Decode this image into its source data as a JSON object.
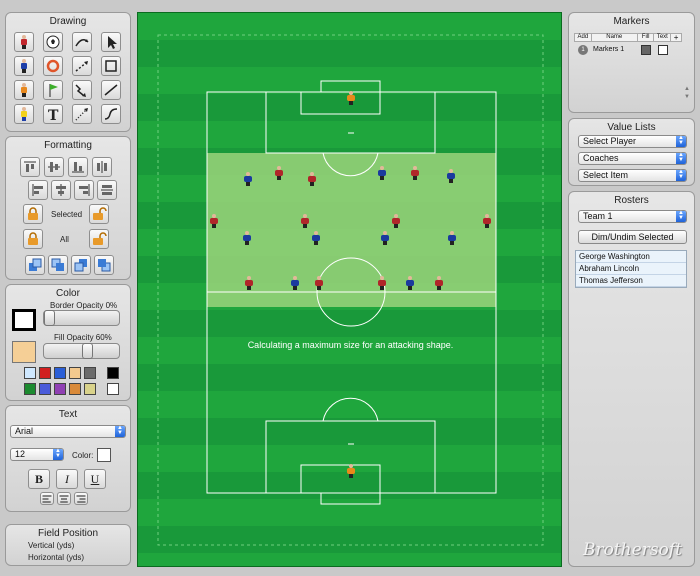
{
  "drawing": {
    "title": "Drawing",
    "tools": [
      {
        "name": "player-red-tool",
        "icon": "player-red-icon"
      },
      {
        "name": "ball-tool",
        "icon": "soccer-ball-icon"
      },
      {
        "name": "curve-arrow-tool",
        "icon": "curved-arrow-icon"
      },
      {
        "name": "select-tool",
        "icon": "pointer-arrow-icon"
      },
      {
        "name": "player-blue-tool",
        "icon": "player-blue-icon"
      },
      {
        "name": "cone-tool",
        "icon": "cone-icon"
      },
      {
        "name": "dashed-arrow-tool",
        "icon": "dashed-arrow-icon"
      },
      {
        "name": "rectangle-tool",
        "icon": "rectangle-icon"
      },
      {
        "name": "player-orange-tool",
        "icon": "player-orange-icon"
      },
      {
        "name": "flag-tool",
        "icon": "flag-icon"
      },
      {
        "name": "zigzag-arrow-tool",
        "icon": "zigzag-arrow-icon"
      },
      {
        "name": "line-tool",
        "icon": "line-icon"
      },
      {
        "name": "player-yellow-tool",
        "icon": "player-yellow-icon"
      },
      {
        "name": "text-tool",
        "icon": "text-T-icon"
      },
      {
        "name": "dotted-arrow-tool",
        "icon": "dotted-arrow-icon"
      },
      {
        "name": "freehand-tool",
        "icon": "freehand-curve-icon"
      }
    ]
  },
  "formatting": {
    "title": "Formatting",
    "selected_label": "Selected",
    "all_label": "All"
  },
  "color": {
    "title": "Color",
    "border_opacity_label": "Border Opacity 0%",
    "fill_opacity_label": "Fill Opacity 60%",
    "border_opacity": 0,
    "fill_opacity": 60,
    "fill_color": "#f5cf96",
    "palette": [
      "#cfe8ff",
      "#d11f1f",
      "#2b5fd6",
      "#f3c98e",
      "#6b6b6b",
      "#1c8a2f",
      "#4a5bd9",
      "#8f3fb3",
      "#d98a3a",
      "#d9d28a"
    ],
    "black": "#000000",
    "white": "#ffffff"
  },
  "text": {
    "title": "Text",
    "font_value": "Arial",
    "size_value": "12",
    "color_label": "Color:",
    "bold": "B",
    "italic": "I",
    "underline": "U"
  },
  "field_position": {
    "title": "Field Position",
    "vertical_label": "Vertical (yds)",
    "horizontal_label": "Horizontal (yds)"
  },
  "pitch": {
    "message": "Calculating a maximum size for an attacking shape."
  },
  "markers": {
    "title": "Markers",
    "columns": [
      "Add",
      "Name",
      "Fill",
      "Text",
      "+"
    ],
    "rows": [
      {
        "number": "1",
        "name": "Markers 1"
      }
    ]
  },
  "value_lists": {
    "title": "Value Lists",
    "player_select": "Select Player",
    "coaches_select": "Coaches",
    "item_select": "Select Item"
  },
  "rosters": {
    "title": "Rosters",
    "team_select": "Team 1",
    "dim_button": "Dim/Undim Selected",
    "players": [
      "George Washington",
      "Abraham Lincoln",
      "Thomas Jefferson"
    ]
  },
  "watermark": "Brothersoft"
}
